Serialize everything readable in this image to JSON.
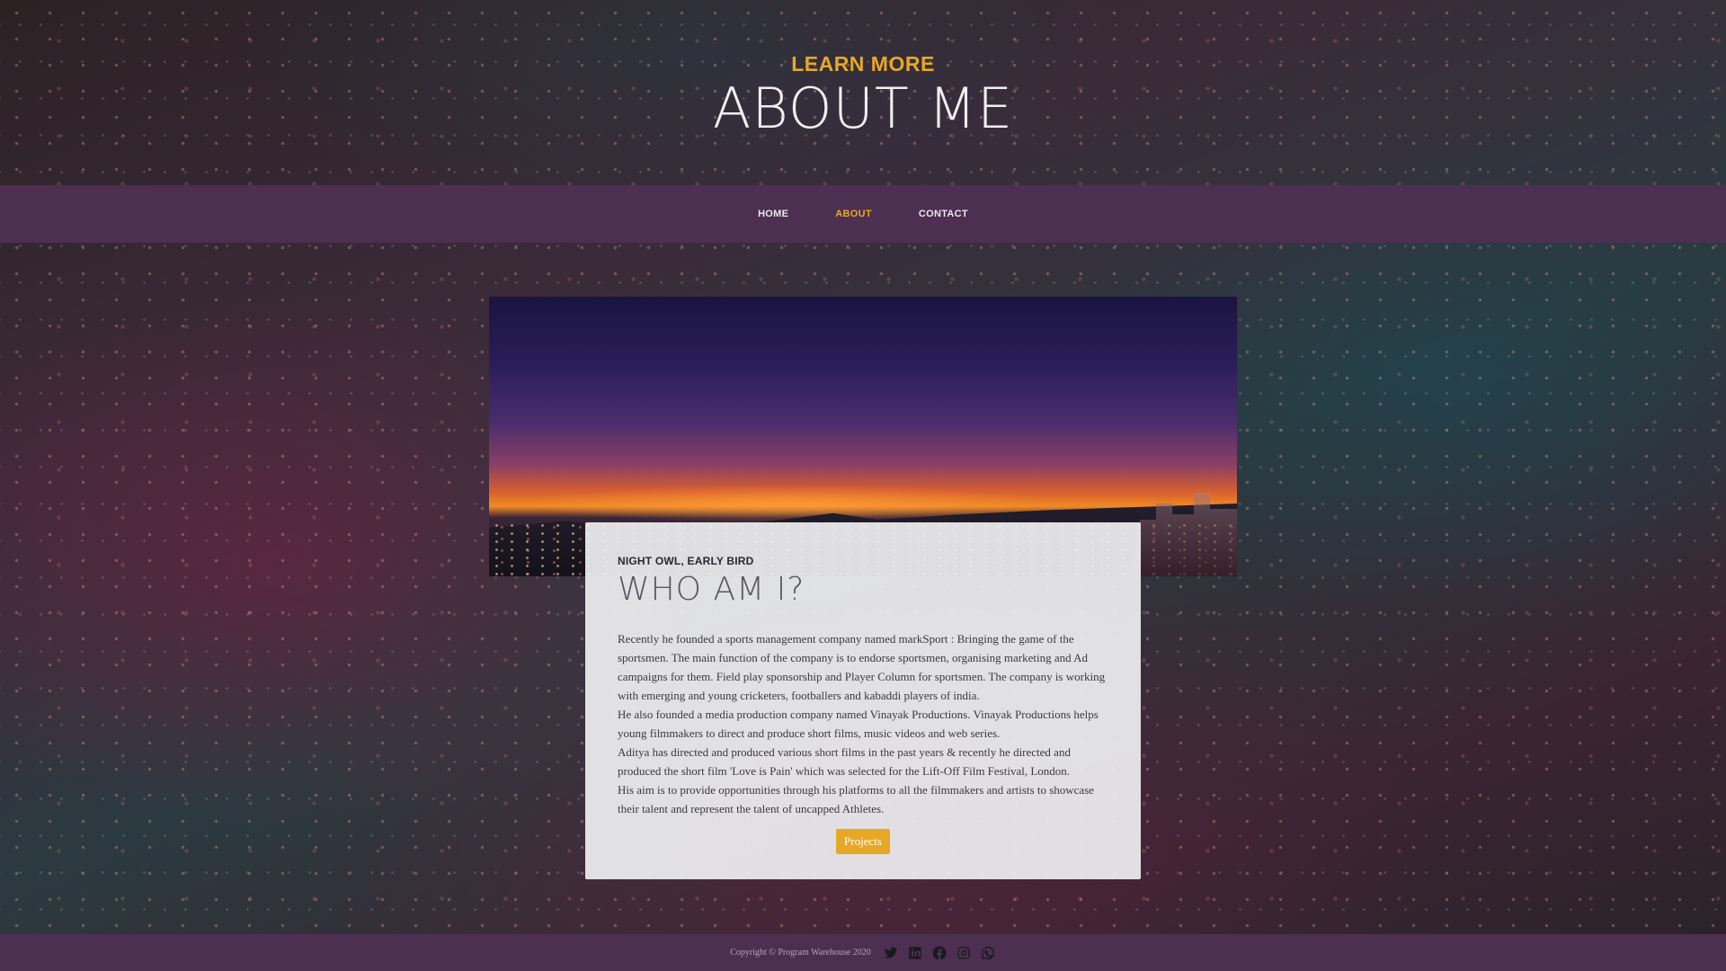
{
  "hero": {
    "subtitle": "LEARN MORE",
    "title": "ABOUT ME"
  },
  "nav": {
    "items": [
      {
        "label": "HOME",
        "active": false
      },
      {
        "label": "ABOUT",
        "active": true
      },
      {
        "label": "CONTACT",
        "active": false
      }
    ]
  },
  "card": {
    "eyebrow": "NIGHT OWL, EARLY BIRD",
    "title": "WHO AM I?",
    "paragraphs": [
      "Recently he founded a sports management company named markSport : Bringing the game of the sportsmen. The main function of the company is to endorse sportsmen, organising marketing and Ad campaigns for them. Field play sponsorship and Player Column for sportsmen. The company is working with emerging and young cricketers, footballers and kabaddi players of india.",
      "He also founded a media production company named Vinayak Productions. Vinayak Productions helps young filmmakers to direct and produce short films, music videos and web series.",
      "Aditya has directed and produced various short films in the past years & recently he directed and produced the short film 'Love is Pain' which was selected for the Lift-Off Film Festival, London.",
      "His aim is to provide opportunities through his platforms to all the filmmakers and artists to showcase their talent and represent the talent of uncapped Athletes."
    ],
    "button_label": "Projects"
  },
  "footer": {
    "copyright": "Copyright © Program Warehouse 2020",
    "social_icons": [
      "twitter-icon",
      "linkedin-icon",
      "facebook-icon",
      "instagram-icon",
      "whatsapp-icon"
    ]
  },
  "colors": {
    "accent": "#e6a825",
    "nav_bg": "#4d2f52",
    "card_bg": "#eeeef0"
  }
}
